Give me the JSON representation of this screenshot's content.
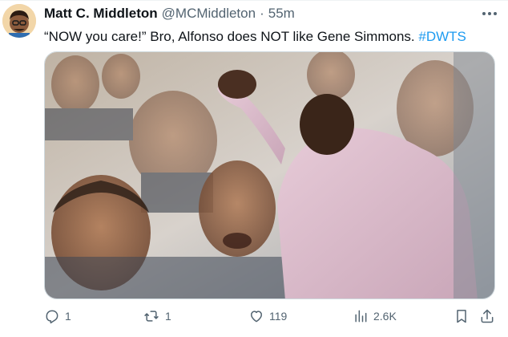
{
  "tweet": {
    "author_name": "Matt C. Middleton",
    "author_handle": "@MCMiddleton",
    "separator": "·",
    "timestamp": "55m",
    "text_main": "“NOW you care!” Bro, Alfonso does NOT like Gene Simmons.",
    "hashtag": "#DWTS"
  },
  "actions": {
    "replies": "1",
    "reposts": "1",
    "likes": "119",
    "views": "2.6K"
  },
  "icons": {
    "more": "more-horizontal-icon",
    "reply": "comment-bubble-icon",
    "repost": "repost-arrows-icon",
    "like": "heart-icon",
    "views": "bar-chart-icon",
    "bookmark": "bookmark-icon",
    "share": "share-upload-icon"
  },
  "colors": {
    "text": "#0f1419",
    "secondary": "#536471",
    "link": "#1d9bf0",
    "border": "#cfd9de"
  }
}
